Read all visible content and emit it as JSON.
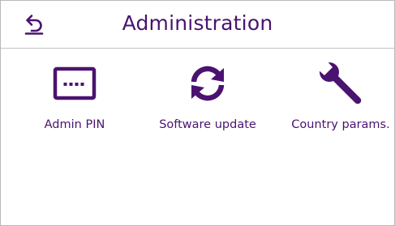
{
  "header": {
    "title": "Administration",
    "back_icon": "back-arrow-icon"
  },
  "tiles": [
    {
      "label": "Admin PIN",
      "icon": "pin-field-icon"
    },
    {
      "label": "Software update",
      "icon": "refresh-icon"
    },
    {
      "label": "Country params.",
      "icon": "wrench-icon"
    }
  ],
  "colors": {
    "accent": "#4a1370",
    "background": "#ffffff",
    "divider": "#c4c4c4"
  }
}
